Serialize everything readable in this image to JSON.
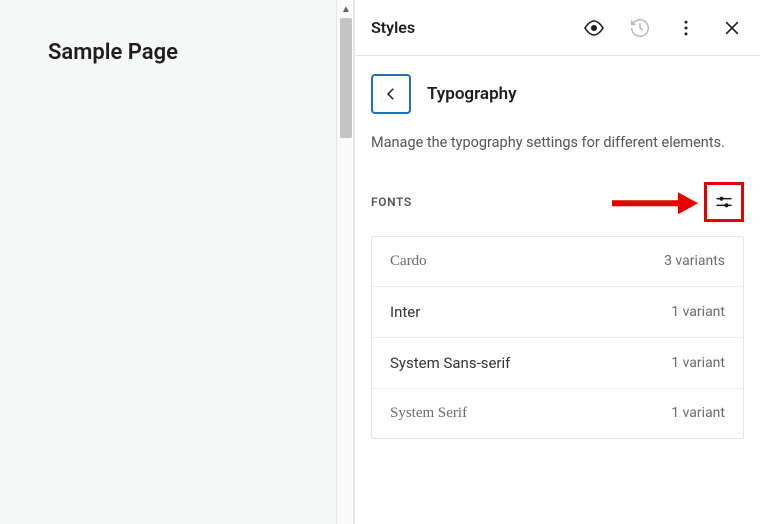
{
  "preview": {
    "title": "Sample Page"
  },
  "sidebar": {
    "header_title": "Styles",
    "panel_title": "Typography",
    "description": "Manage the typography settings for different elements.",
    "section_label": "FONTS"
  },
  "fonts": [
    {
      "name": "Cardo",
      "variants": "3 variants",
      "serif": true
    },
    {
      "name": "Inter",
      "variants": "1 variant",
      "serif": false
    },
    {
      "name": "System Sans-serif",
      "variants": "1 variant",
      "serif": false
    },
    {
      "name": "System Serif",
      "variants": "1 variant",
      "serif": true
    }
  ]
}
